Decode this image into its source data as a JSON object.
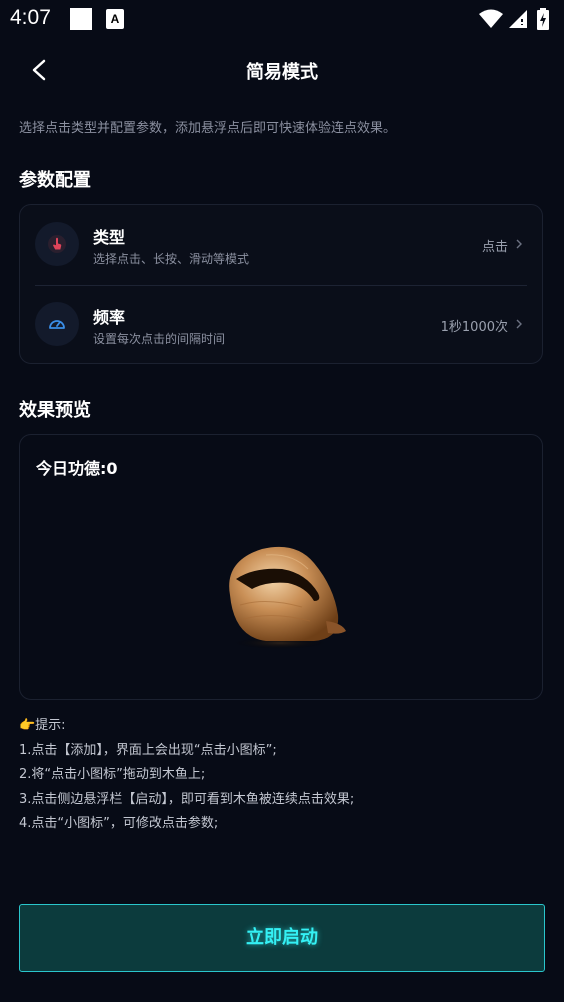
{
  "status_bar": {
    "time": "4:07",
    "notification_letter": "A"
  },
  "header": {
    "title": "简易模式"
  },
  "intro": "选择点击类型并配置参数，添加悬浮点后即可快速体验连点效果。",
  "config": {
    "section_title": "参数配置",
    "rows": [
      {
        "label": "类型",
        "description": "选择点击、长按、滑动等模式",
        "value": "点击",
        "icon": "hand-tap-icon",
        "icon_color": "#e0445a"
      },
      {
        "label": "频率",
        "description": "设置每次点击的间隔时间",
        "value": "1秒1000次",
        "icon": "speedometer-icon",
        "icon_color": "#3a8ee8"
      }
    ]
  },
  "preview": {
    "section_title": "效果预览",
    "merit": "今日功德:0"
  },
  "tips": {
    "title": "👉提示:",
    "items": [
      "1.点击【添加】，界面上会出现“点击小图标”;",
      "2.将“点击小图标”拖动到木鱼上;",
      "3.点击侧边悬浮栏【启动】，即可看到木鱼被连续点击效果;",
      "4.点击“小图标”，可修改点击参数;"
    ]
  },
  "start_button": {
    "label": "立即启动"
  },
  "colors": {
    "background": "#070b16",
    "accent": "#34f0f4",
    "button_bg": "#0c3b3d"
  }
}
